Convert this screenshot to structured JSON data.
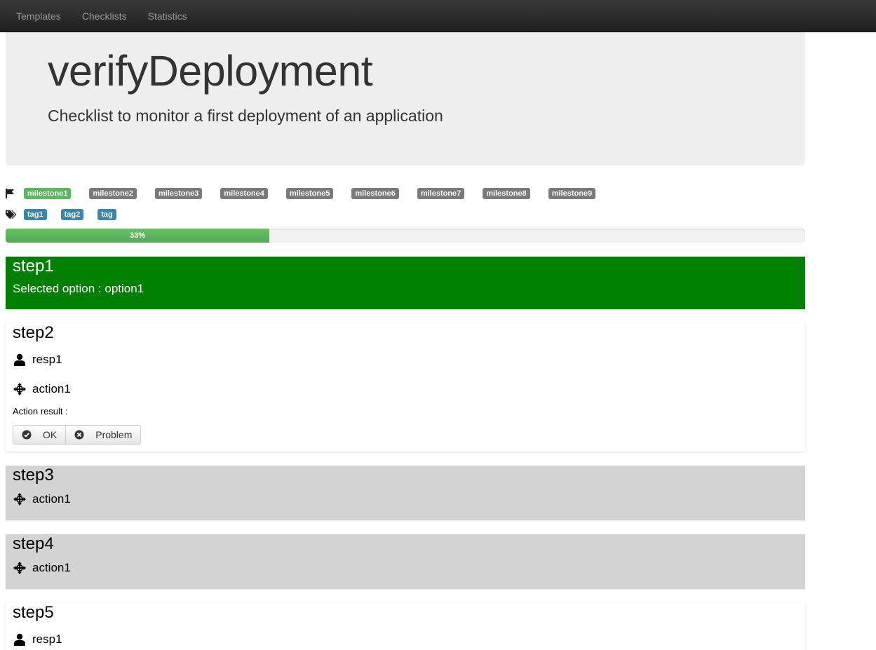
{
  "nav": {
    "items": [
      {
        "label": "Templates"
      },
      {
        "label": "Checklists"
      },
      {
        "label": "Statistics"
      }
    ]
  },
  "hero": {
    "title": "verifyDeployment",
    "subtitle": "Checklist to monitor a first deployment of an application"
  },
  "milestones": {
    "icon": "flag-icon",
    "items": [
      {
        "label": "milestone1",
        "color": "#5cb85c"
      },
      {
        "label": "milestone2",
        "color": "#7a7a7a"
      },
      {
        "label": "milestone3",
        "color": "#7a7a7a"
      },
      {
        "label": "milestone4",
        "color": "#7a7a7a"
      },
      {
        "label": "milestone5",
        "color": "#7a7a7a"
      },
      {
        "label": "milestone6",
        "color": "#7a7a7a"
      },
      {
        "label": "milestone7",
        "color": "#7a7a7a"
      },
      {
        "label": "milestone8",
        "color": "#7a7a7a"
      },
      {
        "label": "milestone9",
        "color": "#7a7a7a"
      }
    ]
  },
  "tags": {
    "icon": "tags-icon",
    "items": [
      {
        "label": "tag1"
      },
      {
        "label": "tag2"
      },
      {
        "label": "tag"
      }
    ]
  },
  "progress": {
    "label": "33%",
    "fraction": 0.33
  },
  "steps": {
    "step1": {
      "title": "step1",
      "selected": "Selected option : option1",
      "color": "#008000"
    },
    "step2": {
      "title": "step2",
      "responsible": "resp1",
      "action": "action1",
      "action_result_label": "Action result :",
      "ok_label": "OK",
      "problem_label": "Problem"
    },
    "step3": {
      "title": "step3",
      "action": "action1",
      "color": "#d3d3d3"
    },
    "step4": {
      "title": "step4",
      "action": "action1",
      "color": "#d3d3d3"
    },
    "step5": {
      "title": "step5",
      "responsible": "resp1"
    }
  }
}
